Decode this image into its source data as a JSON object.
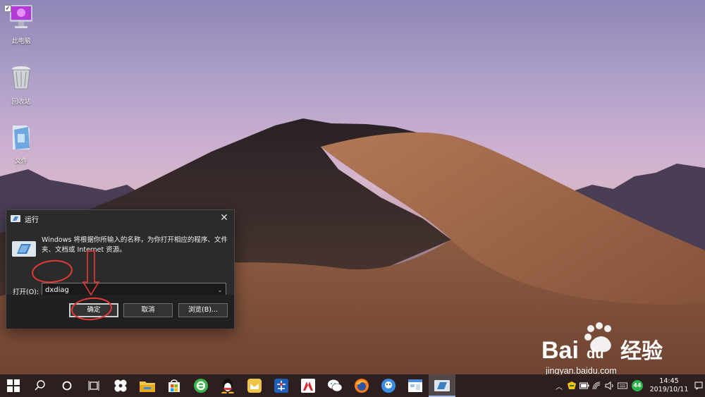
{
  "desktop": {
    "icons": [
      {
        "label": "此电脑",
        "icon": "computer-monitor-icon"
      },
      {
        "label": "回收站",
        "icon": "recycle-bin-icon"
      },
      {
        "label": "文件",
        "icon": "folder-icon"
      }
    ]
  },
  "run_dialog": {
    "title": "运行",
    "close_label": "✕",
    "description": "Windows 将根据你所输入的名称，为你打开相应的程序、文件夹、文档或 Internet 资源。",
    "open_label": "打开(O):",
    "input_value": "dxdiag",
    "buttons": {
      "ok": "确定",
      "cancel": "取消",
      "browse": "浏览(B)..."
    }
  },
  "taskbar": {
    "apps": [
      "start-icon",
      "search-icon",
      "cortana-icon",
      "task-view-icon",
      "pinwheel-icon",
      "file-explorer-icon",
      "store-icon",
      "ie-browser-icon",
      "qq-icon",
      "mail-app-icon",
      "network-tool-icon",
      "pdf-app-icon",
      "wechat-icon",
      "firefox-icon",
      "cloud-app-icon",
      "calendar-app-icon",
      "run-dialog-icon"
    ],
    "active_app": "run-dialog-icon",
    "tray": {
      "badge_count": "44",
      "time": "14:45",
      "date": "2019/10/11"
    }
  },
  "watermark": {
    "brand": "Bai度经验",
    "url": "jingyan.baidu.com"
  },
  "colors": {
    "accent": "#e53935",
    "dialog_bg": "#2b2b2b",
    "taskbar_bg": "#281c1e"
  }
}
